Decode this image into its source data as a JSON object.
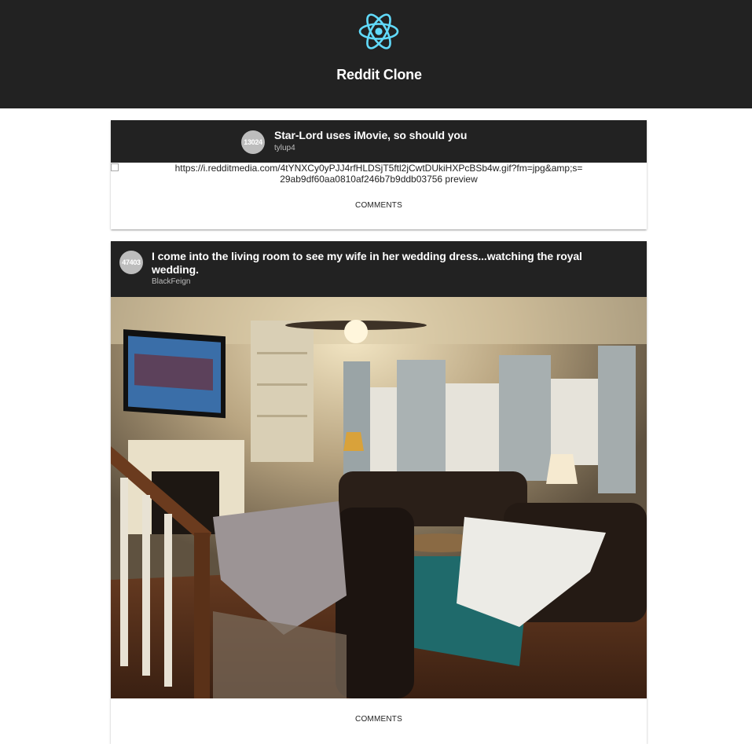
{
  "header": {
    "title": "Reddit Clone",
    "logo_icon": "react-atom-icon",
    "logo_color": "#61dafb"
  },
  "posts": [
    {
      "score": "13024",
      "title": "Star-Lord uses iMovie, so should you",
      "author": "tylup4",
      "image_alt": "https://i.redditmedia.com/4tYNXCy0yPJJ4rfHLDSjT5ftl2jCwtDUkiHXPcBSb4w.gif?fm=jpg&amp;s=29ab9df60aa0810af246b7b9ddb03756 preview",
      "action_label": "COMMENTS"
    },
    {
      "score": "47403",
      "title": "I come into the living room to see my wife in her wedding dress...watching the royal wedding.",
      "author": "BlackFeign",
      "action_label": "COMMENTS"
    }
  ]
}
